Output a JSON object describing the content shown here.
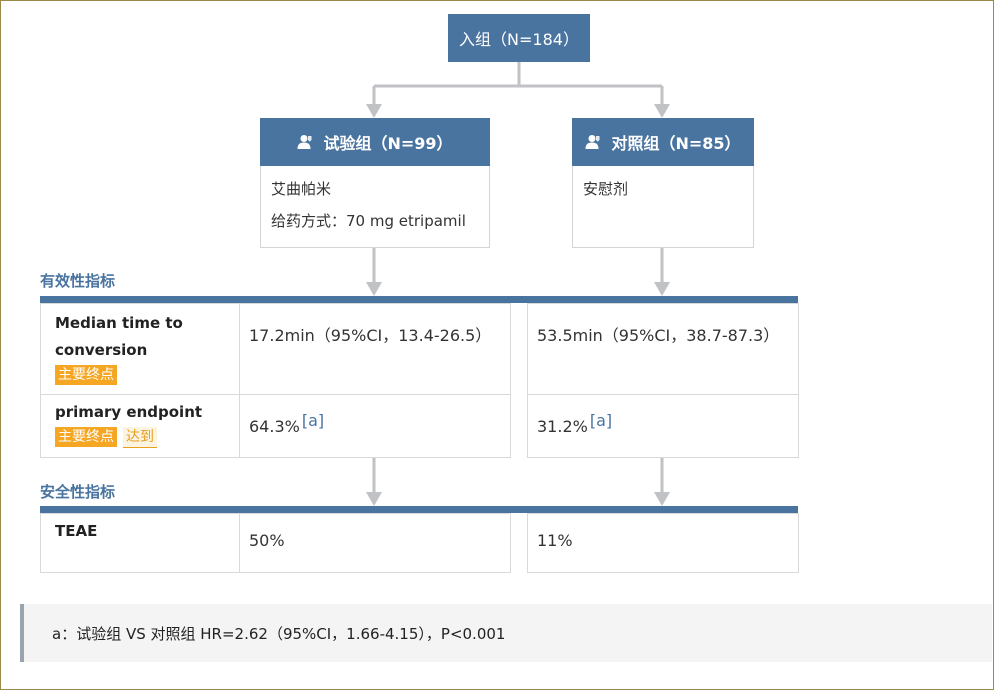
{
  "root": {
    "label": "入组（N=184）"
  },
  "arms": [
    {
      "header": "试验组（N=99）",
      "lines": [
        "艾曲帕米",
        "给药方式：70 mg etripamil"
      ]
    },
    {
      "header": "对照组（N=85）",
      "lines": [
        "安慰剂"
      ]
    }
  ],
  "efficacy": {
    "title": "有效性指标",
    "rows": [
      {
        "label_lines": [
          "Median time to",
          "conversion"
        ],
        "tags": [
          "主要终点"
        ],
        "values": [
          {
            "text": "17.2min（95%CI，13.4-26.5）",
            "ref": ""
          },
          {
            "text": "53.5min（95%CI，38.7-87.3）",
            "ref": ""
          }
        ]
      },
      {
        "label_lines": [
          "primary endpoint"
        ],
        "tags": [
          "主要终点",
          "达到"
        ],
        "values": [
          {
            "text": "64.3%",
            "ref": "[a]"
          },
          {
            "text": "31.2%",
            "ref": "[a]"
          }
        ]
      }
    ]
  },
  "safety": {
    "title": "安全性指标",
    "rows": [
      {
        "label": "TEAE",
        "values": [
          "50%",
          "11%"
        ]
      }
    ]
  },
  "footnote": "a：试验组 VS 对照组 HR=2.62（95%CI，1.66-4.15），P<0.001",
  "colors": {
    "header_blue": "#4a74a0",
    "connector_gray": "#c0c2c6",
    "tag_orange": "#f5a623",
    "border_gray": "#d9d9d9"
  },
  "icons": {
    "arm_header": "person-icon"
  }
}
